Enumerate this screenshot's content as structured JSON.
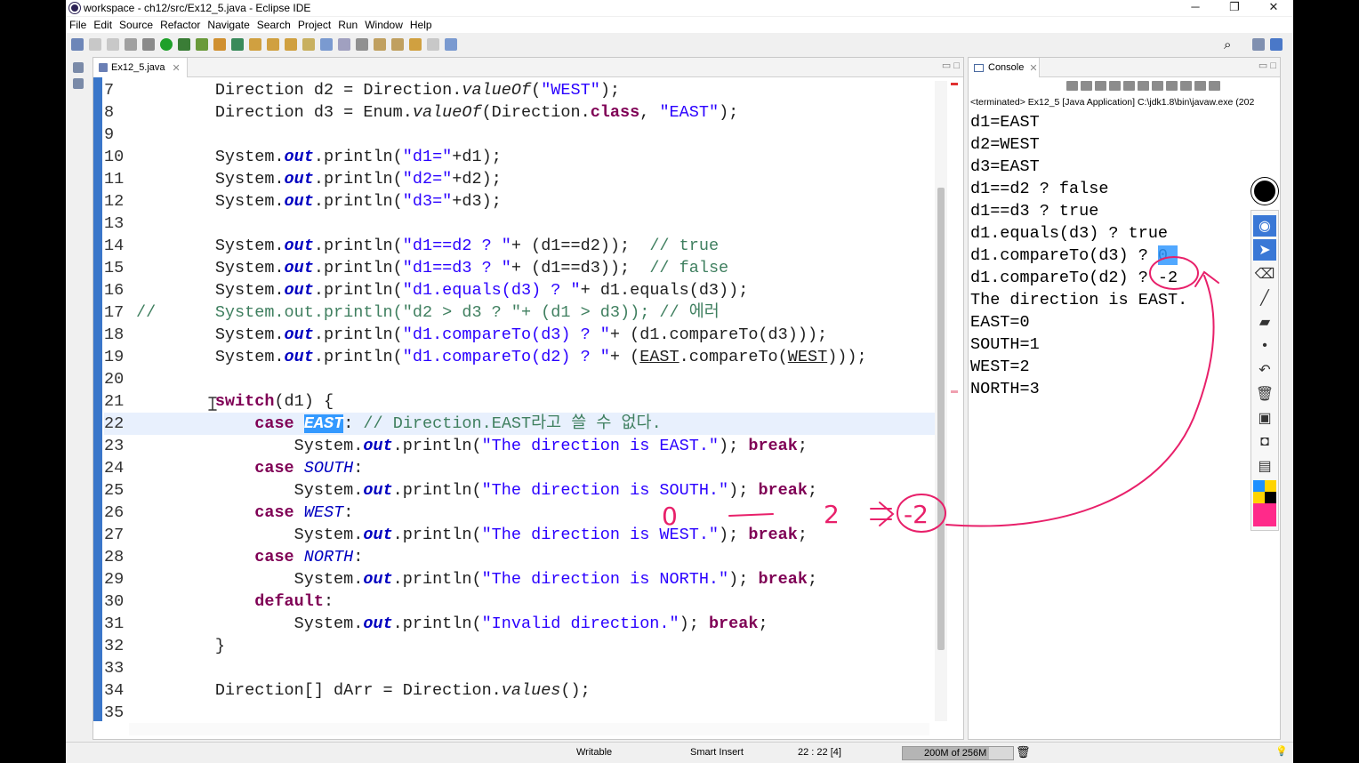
{
  "window": {
    "title": "workspace - ch12/src/Ex12_5.java - Eclipse IDE"
  },
  "menu": [
    "File",
    "Edit",
    "Source",
    "Refactor",
    "Navigate",
    "Search",
    "Project",
    "Run",
    "Window",
    "Help"
  ],
  "editor": {
    "tab_label": "Ex12_5.java"
  },
  "code_lines": [
    {
      "n": "7",
      "t": "        Direction d2 = Direction.valueOf(\"WEST\");"
    },
    {
      "n": "8",
      "t": "        Direction d3 = Enum.valueOf(Direction.class, \"EAST\");"
    },
    {
      "n": "9",
      "t": ""
    },
    {
      "n": "10",
      "t": "        System.out.println(\"d1=\"+d1);"
    },
    {
      "n": "11",
      "t": "        System.out.println(\"d2=\"+d2);"
    },
    {
      "n": "12",
      "t": "        System.out.println(\"d3=\"+d3);"
    },
    {
      "n": "13",
      "t": ""
    },
    {
      "n": "14",
      "t": "        System.out.println(\"d1==d2 ? \"+ (d1==d2));  // true"
    },
    {
      "n": "15",
      "t": "        System.out.println(\"d1==d3 ? \"+ (d1==d3));  // false"
    },
    {
      "n": "16",
      "t": "        System.out.println(\"d1.equals(d3) ? \"+ d1.equals(d3));"
    },
    {
      "n": "17",
      "t": "//      System.out.println(\"d2 > d3 ? \"+ (d1 > d3)); // 에러"
    },
    {
      "n": "18",
      "t": "        System.out.println(\"d1.compareTo(d3) ? \"+ (d1.compareTo(d3)));"
    },
    {
      "n": "19",
      "t": "        System.out.println(\"d1.compareTo(d2) ? \"+ (EAST.compareTo(WEST)));"
    },
    {
      "n": "20",
      "t": ""
    },
    {
      "n": "21",
      "t": "        switch(d1) {"
    },
    {
      "n": "22",
      "t": "            case EAST: // Direction.EAST라고 쓸 수 없다."
    },
    {
      "n": "23",
      "t": "                System.out.println(\"The direction is EAST.\"); break;"
    },
    {
      "n": "24",
      "t": "            case SOUTH:"
    },
    {
      "n": "25",
      "t": "                System.out.println(\"The direction is SOUTH.\"); break;"
    },
    {
      "n": "26",
      "t": "            case WEST:"
    },
    {
      "n": "27",
      "t": "                System.out.println(\"The direction is WEST.\"); break;"
    },
    {
      "n": "28",
      "t": "            case NORTH:"
    },
    {
      "n": "29",
      "t": "                System.out.println(\"The direction is NORTH.\"); break;"
    },
    {
      "n": "30",
      "t": "            default:"
    },
    {
      "n": "31",
      "t": "                System.out.println(\"Invalid direction.\"); break;"
    },
    {
      "n": "32",
      "t": "        }"
    },
    {
      "n": "33",
      "t": ""
    },
    {
      "n": "34",
      "t": "        Direction[] dArr = Direction.values();"
    },
    {
      "n": "35",
      "t": ""
    }
  ],
  "console": {
    "tab_label": "Console",
    "terminated": "<terminated> Ex12_5 [Java Application] C:\\jdk1.8\\bin\\javaw.exe (202",
    "lines": [
      "d1=EAST",
      "d2=WEST",
      "d3=EAST",
      "d1==d2 ? false",
      "d1==d3 ? true",
      "d1.equals(d3) ? true",
      "d1.compareTo(d3) ? 0",
      "d1.compareTo(d2) ? -2",
      "The direction is EAST.",
      "EAST=0",
      "SOUTH=1",
      "WEST=2",
      "NORTH=3"
    ]
  },
  "annotation": {
    "text_0": "0",
    "text_2": "2",
    "text_m2": "-2"
  },
  "status": {
    "writable": "Writable",
    "insert_mode": "Smart Insert",
    "position": "22 : 22 [4]",
    "heap": "200M of 256M",
    "heap_used_fraction": 0.78
  },
  "colors": {
    "accent": "#3399ff",
    "keyword": "#7f0055",
    "string": "#2a00ff",
    "comment": "#3f7f5f",
    "pen": "#e8206a"
  }
}
